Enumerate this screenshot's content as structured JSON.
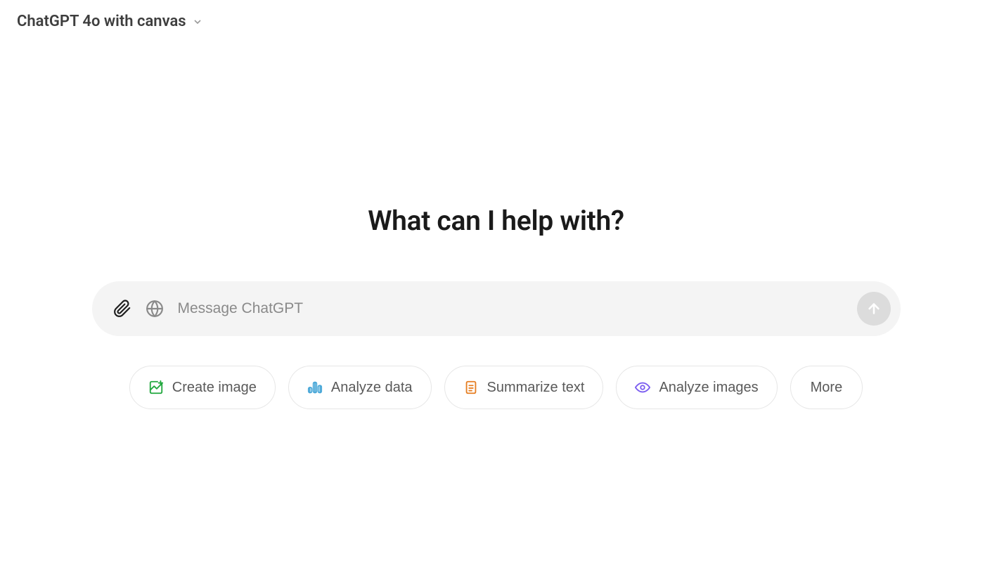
{
  "header": {
    "model_label": "ChatGPT 4o with canvas"
  },
  "heading": "What can I help with?",
  "input": {
    "placeholder": "Message ChatGPT",
    "value": ""
  },
  "pills": {
    "create_image": "Create image",
    "analyze_data": "Analyze data",
    "summarize_text": "Summarize text",
    "analyze_images": "Analyze images",
    "more": "More"
  },
  "colors": {
    "icon_green": "#22a83f",
    "icon_blue": "#4aa8d8",
    "icon_orange": "#e67e22",
    "icon_purple": "#7a5cf0"
  }
}
